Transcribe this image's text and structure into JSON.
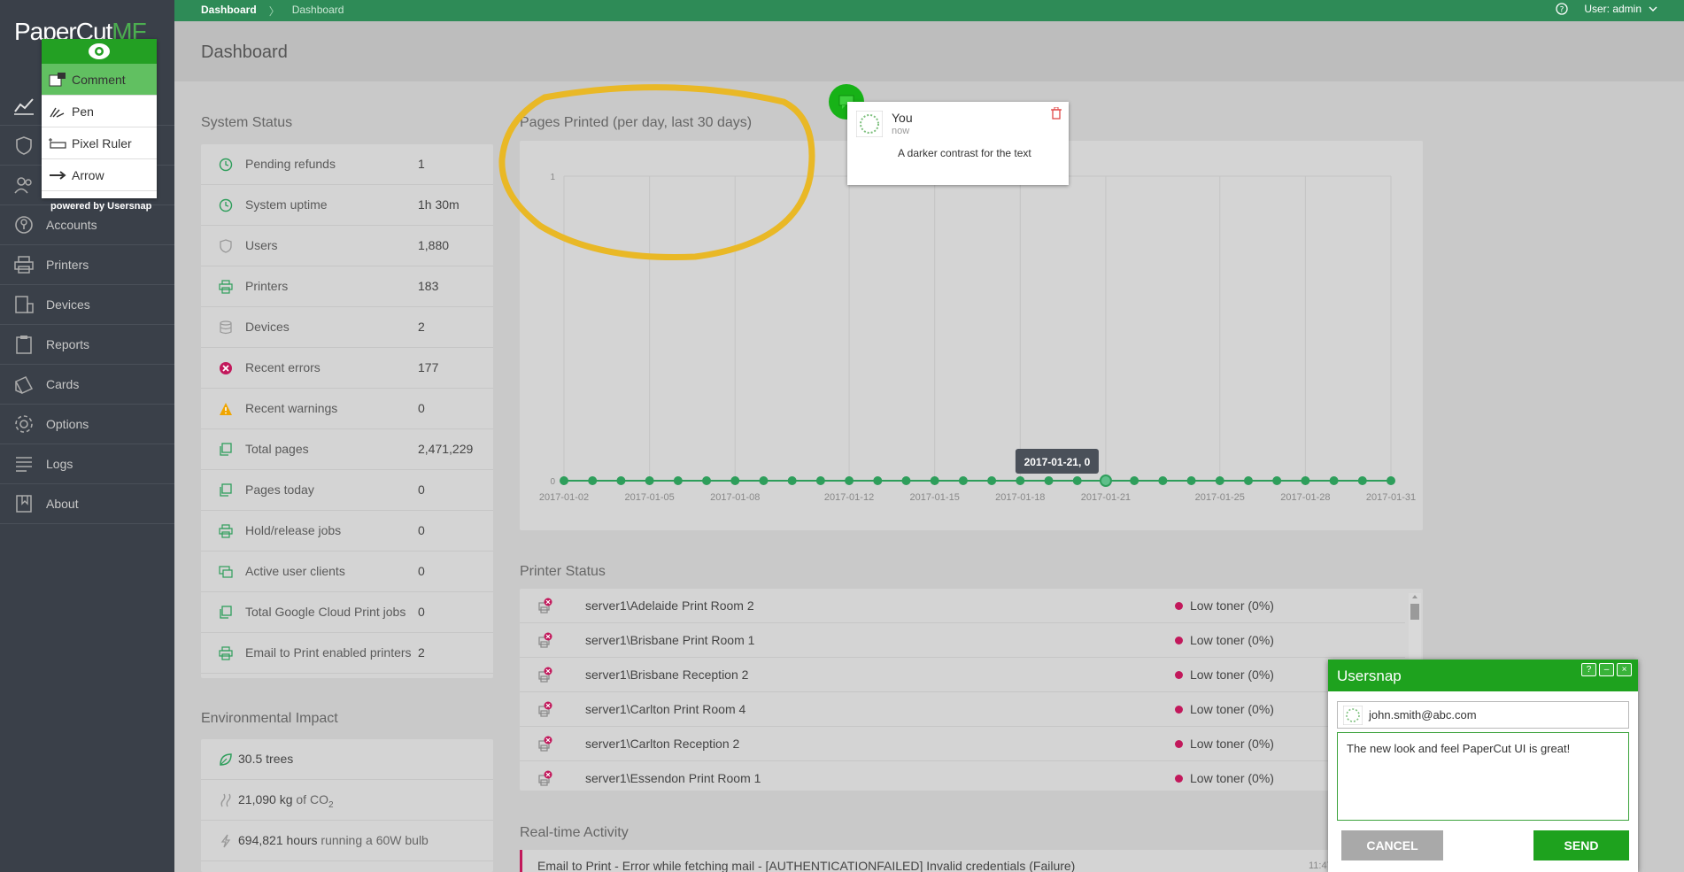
{
  "app": {
    "logo_main": "PaperCut",
    "logo_suffix": "MF"
  },
  "topbar": {
    "breadcrumb": [
      "Dashboard",
      "Dashboard"
    ],
    "user_label": "User: admin"
  },
  "page": {
    "title": "Dashboard"
  },
  "sidebar": {
    "items": [
      {
        "label": "",
        "icon": "chart-icon"
      },
      {
        "label": "",
        "icon": "shield-icon"
      },
      {
        "label": "",
        "icon": "users-icon"
      },
      {
        "label": "Accounts",
        "icon": "accounts-icon"
      },
      {
        "label": "Printers",
        "icon": "printer-icon"
      },
      {
        "label": "Devices",
        "icon": "device-icon"
      },
      {
        "label": "Reports",
        "icon": "clipboard-icon"
      },
      {
        "label": "Cards",
        "icon": "cards-icon"
      },
      {
        "label": "Options",
        "icon": "gear-icon"
      },
      {
        "label": "Logs",
        "icon": "lines-icon"
      },
      {
        "label": "About",
        "icon": "book-icon"
      }
    ]
  },
  "system_status": {
    "title": "System Status",
    "rows": [
      {
        "label": "Pending refunds",
        "value": "1",
        "icon": "clock-icon"
      },
      {
        "label": "System uptime",
        "value": "1h 30m",
        "icon": "clock-icon"
      },
      {
        "label": "Users",
        "value": "1,880",
        "icon": "shield-icon"
      },
      {
        "label": "Printers",
        "value": "183",
        "icon": "printer-icon"
      },
      {
        "label": "Devices",
        "value": "2",
        "icon": "database-icon"
      },
      {
        "label": "Recent errors",
        "value": "177",
        "icon": "error-icon"
      },
      {
        "label": "Recent warnings",
        "value": "0",
        "icon": "warning-icon"
      },
      {
        "label": "Total pages",
        "value": "2,471,229",
        "icon": "pages-icon"
      },
      {
        "label": "Pages today",
        "value": "0",
        "icon": "pages-icon"
      },
      {
        "label": "Hold/release jobs",
        "value": "0",
        "icon": "printer-icon"
      },
      {
        "label": "Active user clients",
        "value": "0",
        "icon": "monitor-icon"
      },
      {
        "label": "Total Google Cloud Print jobs",
        "value": "0",
        "icon": "pages-icon"
      },
      {
        "label": "Email to Print enabled printers",
        "value": "2",
        "icon": "printer-icon"
      }
    ]
  },
  "environment": {
    "title": "Environmental Impact",
    "rows": [
      {
        "value": "30.5 trees",
        "suffix": "",
        "icon": "leaf-icon"
      },
      {
        "value": "21,090 kg",
        "suffix": "of CO",
        "sub": "2",
        "icon": "smoke-icon"
      },
      {
        "value": "694,821 hours",
        "suffix": "running a 60W bulb",
        "icon": "bolt-icon"
      }
    ]
  },
  "chart": {
    "title": "Pages Printed (per day, last 30 days)",
    "tooltip": "2017-01-21, 0"
  },
  "chart_data": {
    "type": "line",
    "title": "Pages Printed (per day, last 30 days)",
    "x_tick_labels": [
      "2017-01-02",
      "2017-01-05",
      "2017-01-08",
      "2017-01-12",
      "2017-01-15",
      "2017-01-18",
      "2017-01-21",
      "2017-01-25",
      "2017-01-28",
      "2017-01-31"
    ],
    "y_tick_labels": [
      "0",
      "1"
    ],
    "ylim": [
      0,
      1
    ],
    "x": [
      "2017-01-02",
      "2017-01-03",
      "2017-01-04",
      "2017-01-05",
      "2017-01-06",
      "2017-01-07",
      "2017-01-08",
      "2017-01-09",
      "2017-01-10",
      "2017-01-11",
      "2017-01-12",
      "2017-01-13",
      "2017-01-14",
      "2017-01-15",
      "2017-01-16",
      "2017-01-17",
      "2017-01-18",
      "2017-01-19",
      "2017-01-20",
      "2017-01-21",
      "2017-01-22",
      "2017-01-23",
      "2017-01-24",
      "2017-01-25",
      "2017-01-26",
      "2017-01-27",
      "2017-01-28",
      "2017-01-29",
      "2017-01-30",
      "2017-01-31"
    ],
    "values": [
      0,
      0,
      0,
      0,
      0,
      0,
      0,
      0,
      0,
      0,
      0,
      0,
      0,
      0,
      0,
      0,
      0,
      0,
      0,
      0,
      0,
      0,
      0,
      0,
      0,
      0,
      0,
      0,
      0,
      0
    ],
    "highlight_x": "2017-01-21",
    "grid": true,
    "series_color": "#2e9e5b"
  },
  "printer_status": {
    "title": "Printer Status",
    "rows": [
      {
        "name": "server1\\Adelaide Print Room 2",
        "status": "Low toner (0%)"
      },
      {
        "name": "server1\\Brisbane Print Room 1",
        "status": "Low toner (0%)"
      },
      {
        "name": "server1\\Brisbane Reception 2",
        "status": "Low toner (0%)"
      },
      {
        "name": "server1\\Carlton Print Room 4",
        "status": "Low toner (0%)"
      },
      {
        "name": "server1\\Carlton Reception 2",
        "status": "Low toner (0%)"
      },
      {
        "name": "server1\\Essendon Print Room 1",
        "status": "Low toner (0%)"
      }
    ]
  },
  "activity": {
    "title": "Real-time Activity",
    "first_row": "Email to Print - Error while fetching mail - [AUTHENTICATIONFAILED] Invalid credentials (Failure)",
    "first_time": "11:47"
  },
  "usersnap_tools": {
    "items": [
      {
        "label": "Comment",
        "active": true
      },
      {
        "label": "Pen"
      },
      {
        "label": "Pixel Ruler"
      },
      {
        "label": "Arrow"
      }
    ],
    "powered_by": "powered by Usersnap"
  },
  "comment": {
    "author": "You",
    "time": "now",
    "text": "A darker contrast for the text"
  },
  "usersnap": {
    "title": "Usersnap",
    "controls": [
      "?",
      "–",
      "×"
    ],
    "email": "john.smith@abc.com",
    "message": "The new look and feel PaperCut UI is great!",
    "cancel_label": "CANCEL",
    "send_label": "SEND"
  },
  "colors": {
    "sidebar_bg": "#3a4049",
    "topbar_green": "#2e8b57",
    "usersnap_green": "#1ea21e",
    "error_pink": "#c2185b",
    "annotation_yellow": "#e9b826"
  }
}
